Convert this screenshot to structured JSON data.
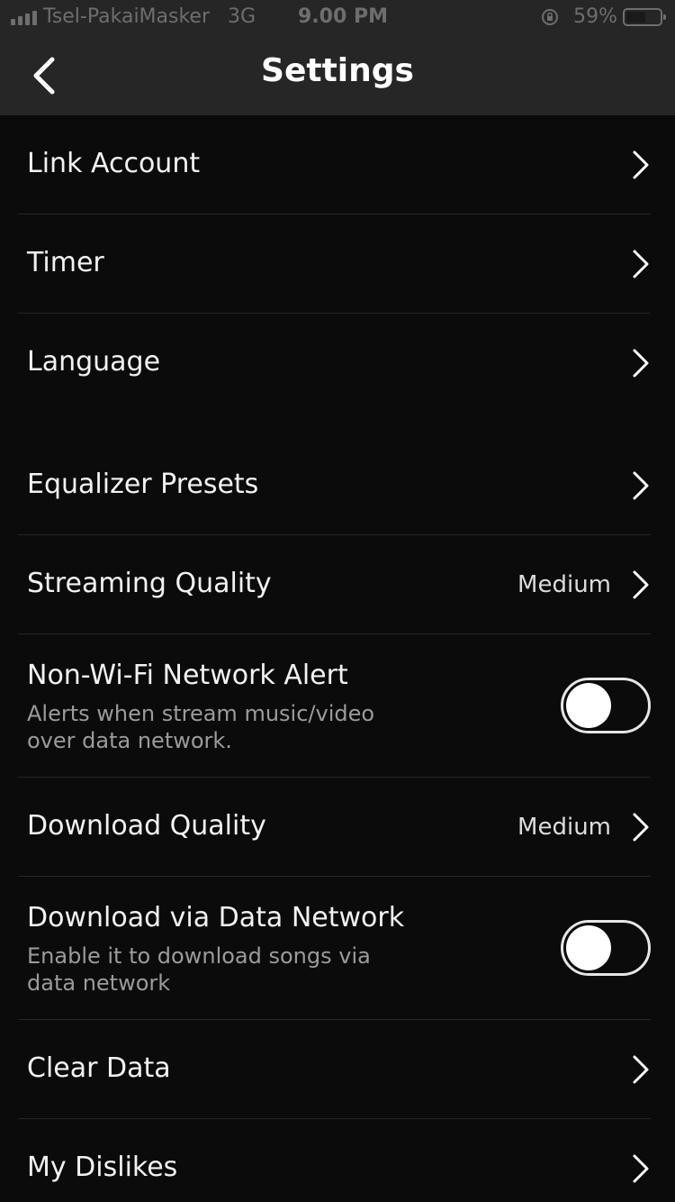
{
  "status_bar": {
    "carrier": "Tsel-PakaiMasker",
    "network": "3G",
    "time": "9.00 PM",
    "battery": "59%",
    "battery_level": 0.59
  },
  "header": {
    "title": "Settings",
    "back_icon": "chevron-left-icon"
  },
  "colors": {
    "background": "#0b0b0b",
    "bar": "#262626",
    "divider": "#262626",
    "text_primary": "#f2f2f2",
    "text_secondary": "#9b9b9b"
  },
  "settings": {
    "link_account": {
      "label": "Link Account"
    },
    "timer": {
      "label": "Timer"
    },
    "language": {
      "label": "Language"
    },
    "equalizer_presets": {
      "label": "Equalizer Presets"
    },
    "streaming_quality": {
      "label": "Streaming Quality",
      "value": "Medium"
    },
    "non_wifi_alert": {
      "label": "Non-Wi-Fi Network Alert",
      "description": "Alerts when stream music/video over data network.",
      "enabled": false
    },
    "download_quality": {
      "label": "Download Quality",
      "value": "Medium"
    },
    "download_via_data": {
      "label": "Download via Data Network",
      "description": "Enable it to download songs via data network",
      "enabled": false
    },
    "clear_data": {
      "label": "Clear Data"
    },
    "my_dislikes": {
      "label": "My Dislikes"
    }
  }
}
